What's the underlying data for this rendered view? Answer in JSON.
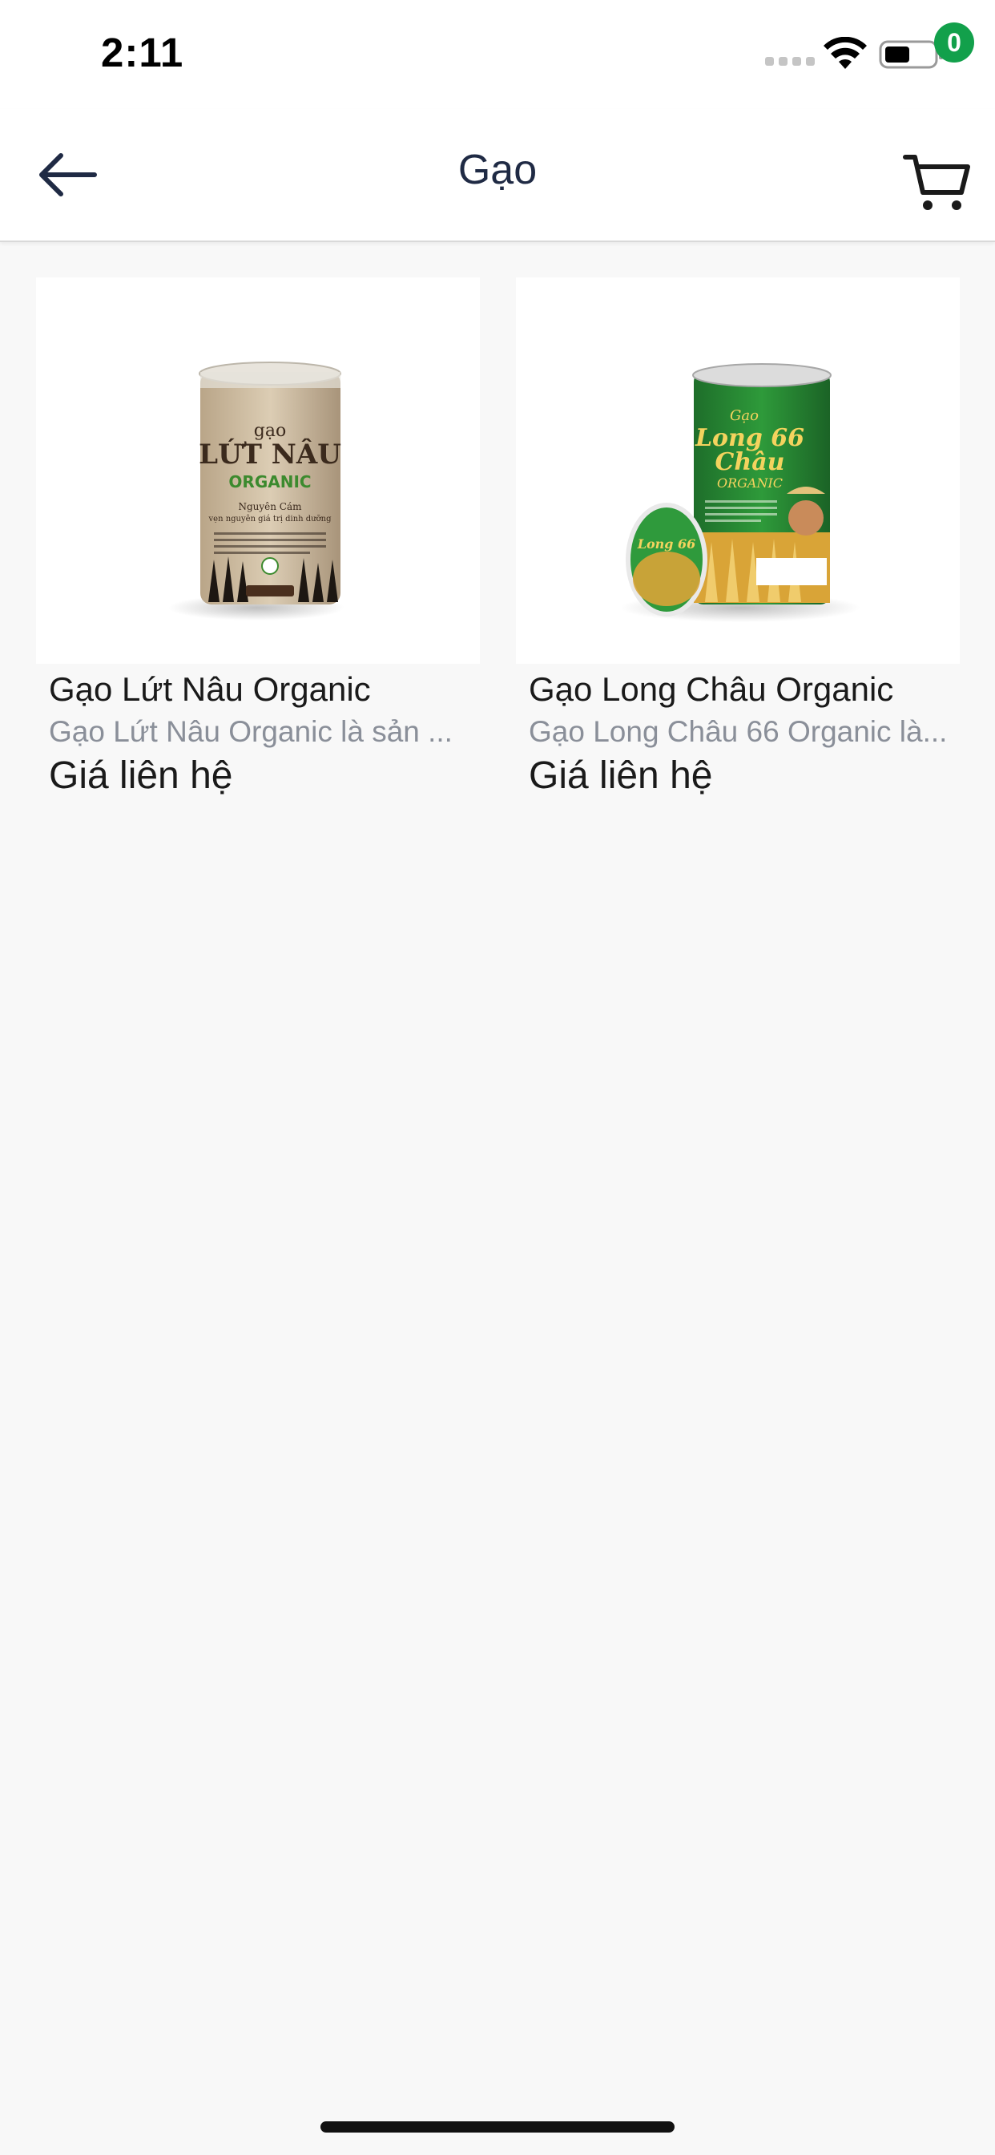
{
  "status_bar": {
    "time": "2:11"
  },
  "header": {
    "title": "Gạo",
    "cart_count": "0"
  },
  "products": [
    {
      "name": "Gạo Lứt Nâu Organic",
      "description": "Gạo Lứt Nâu Organic là sản ...",
      "price": "Giá liên hệ",
      "package": {
        "brand_small": "gạo",
        "brand_big": "LỨT NÂU",
        "tag": "ORGANIC",
        "sub1": "Nguyên Cám",
        "sub2": "vẹn nguyên giá trị dinh dưỡng"
      }
    },
    {
      "name": "Gạo Long Châu Organic",
      "description": "Gạo Long Châu 66 Organic là...",
      "price": "Giá liên hệ",
      "package": {
        "brand_small": "Gạo",
        "brand_big1": "Long 66",
        "brand_big2": "Châu",
        "tag": "ORGANIC"
      }
    }
  ],
  "colors": {
    "accent_green": "#12a04b",
    "title_navy": "#1f2a44",
    "secondary_text": "#8a8f99"
  }
}
